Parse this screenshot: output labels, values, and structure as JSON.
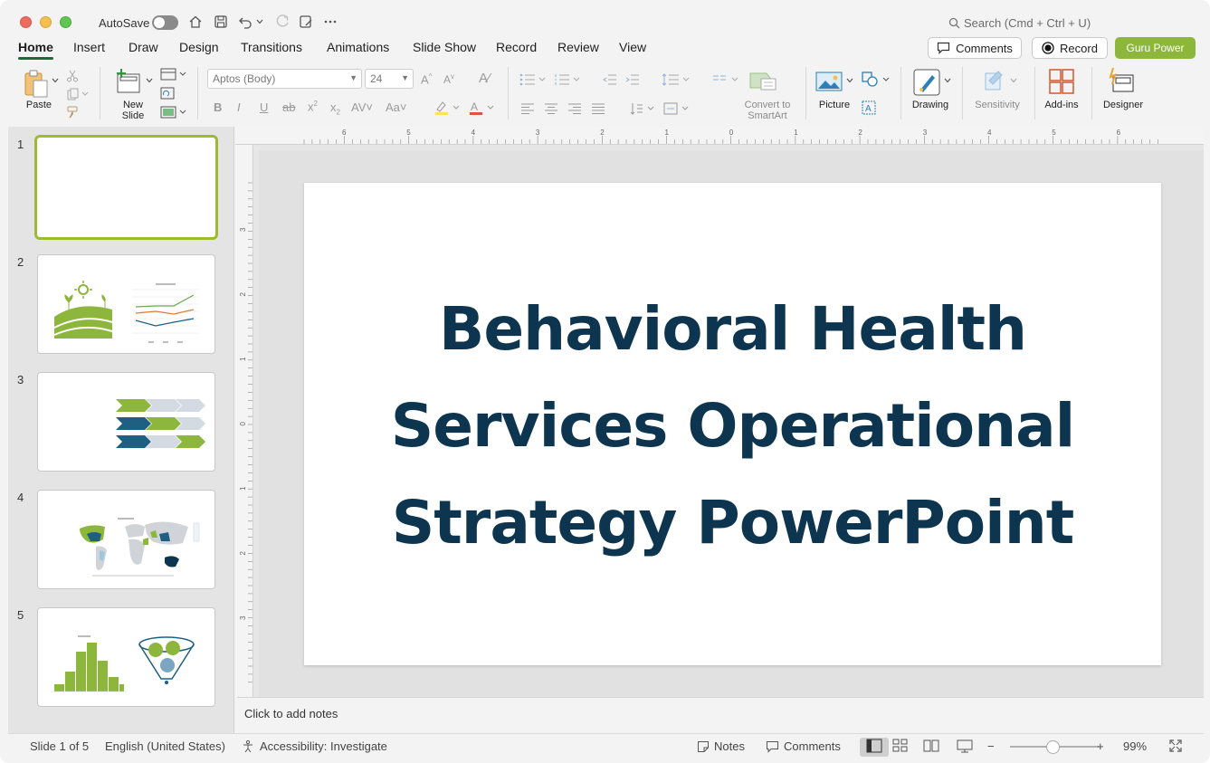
{
  "titlebar": {
    "autosave_label": "AutoSave",
    "autosave_on": false,
    "search_placeholder": "Search (Cmd + Ctrl + U)"
  },
  "menu": {
    "tabs": [
      "Home",
      "Insert",
      "Draw",
      "Design",
      "Transitions",
      "Animations",
      "Slide Show",
      "Record",
      "Review",
      "View"
    ],
    "active_tab": "Home",
    "comments_label": "Comments",
    "record_label": "Record",
    "guru_label": "Guru Power",
    "guru_color": "#8db63c"
  },
  "ribbon": {
    "paste_label": "Paste",
    "new_slide_label": "New Slide",
    "font_name": "Aptos (Body)",
    "font_size": "24",
    "convert_label": "Convert to SmartArt",
    "picture_label": "Picture",
    "drawing_label": "Drawing",
    "sensitivity_label": "Sensitivity",
    "addins_label": "Add-ins",
    "designer_label": "Designer"
  },
  "thumbnails": [
    {
      "number": "1",
      "selected": true
    },
    {
      "number": "2",
      "selected": false
    },
    {
      "number": "3",
      "selected": false
    },
    {
      "number": "4",
      "selected": false
    },
    {
      "number": "5",
      "selected": false
    }
  ],
  "ruler": {
    "h_ticks": [
      "6",
      "5",
      "4",
      "3",
      "2",
      "1",
      "0",
      "1",
      "2",
      "3",
      "4",
      "5",
      "6"
    ],
    "v_ticks": [
      "3",
      "2",
      "1",
      "0",
      "1",
      "2",
      "3"
    ]
  },
  "slide": {
    "title": "Behavioral Health Services Operational Strategy PowerPoint",
    "title_color": "#0d3550"
  },
  "notes": {
    "placeholder": "Click to add notes"
  },
  "status": {
    "slide_counter": "Slide 1 of 5",
    "language": "English (United States)",
    "accessibility": "Accessibility: Investigate",
    "notes_label": "Notes",
    "comments_label": "Comments",
    "zoom": "99%",
    "zoom_level": 0.5
  },
  "colors": {
    "accent_green": "#9dbb2f",
    "navy": "#0d3550",
    "teal": "#1f5f82"
  }
}
